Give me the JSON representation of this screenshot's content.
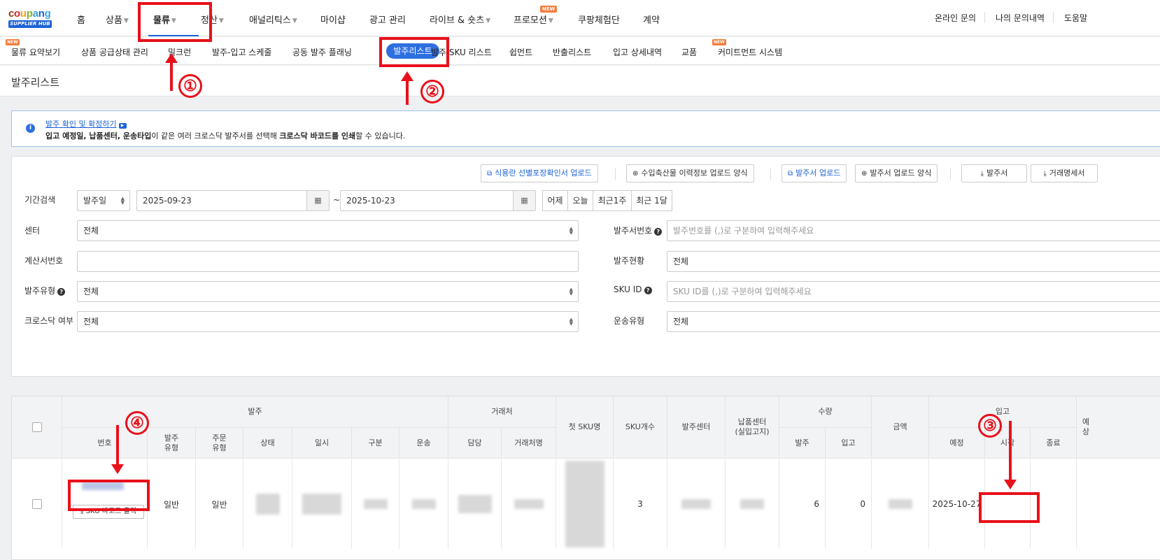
{
  "logo": {
    "word": "coupang",
    "badge": "SUPPLIER HUB"
  },
  "topnav": {
    "items": [
      {
        "label": "홈"
      },
      {
        "label": "상품"
      },
      {
        "label": "물류"
      },
      {
        "label": "정산"
      },
      {
        "label": "애널리틱스"
      },
      {
        "label": "마이샵"
      },
      {
        "label": "광고 관리"
      },
      {
        "label": "라이브 & 숏츠"
      },
      {
        "label": "프로모션"
      },
      {
        "label": "쿠팡체험단"
      },
      {
        "label": "계약"
      }
    ],
    "new_badge": "NEW",
    "right": [
      {
        "label": "온라인 문의"
      },
      {
        "label": "나의 문의내역"
      },
      {
        "label": "도움말"
      }
    ]
  },
  "subnav": {
    "items": [
      {
        "label": "물류 요약보기"
      },
      {
        "label": "상품 공급상태 관리"
      },
      {
        "label": "밀크런"
      },
      {
        "label": "발주-입고 스케줄"
      },
      {
        "label": "공동 발주 플래닝"
      },
      {
        "label": "발주리스트"
      },
      {
        "label": "발주 SKU 리스트"
      },
      {
        "label": "쉽먼트"
      },
      {
        "label": "반출리스트"
      },
      {
        "label": "입고 상세내역"
      },
      {
        "label": "교품"
      },
      {
        "label": "커미트먼트 시스템"
      }
    ],
    "new_badge": "NEW"
  },
  "page_title": "발주리스트",
  "info": {
    "link": "발주 확인 및 확정하기",
    "text_b1": "입고 예정일, 납품센터, 운송타입",
    "text_1": "이 같은 여러 크로스닥 발주서를 선택해 ",
    "text_b2": "크로스닥 바코드를 인쇄",
    "text_2": "할 수 있습니다."
  },
  "toolbar": {
    "food_upload": "식용란 선별포장확인서 업로드",
    "livestock_form": "수입축산물 이력정보 업로드 양식",
    "po_upload": "발주서 업로드",
    "po_upload_form": "발주서 업로드 양식",
    "po_download": "발주서",
    "statement_download": "거래명세서"
  },
  "filters": {
    "period_label": "기간검색",
    "period_type": "발주일",
    "date_from": "2025-09-23",
    "date_sep": "~",
    "date_to": "2025-10-23",
    "quick": [
      "어제",
      "오늘",
      "최근1주",
      "최근 1달"
    ],
    "center_label": "센터",
    "center_value": "전체",
    "invoice_label": "계산서번호",
    "invoice_value": "",
    "type_label": "발주유형",
    "type_value": "전체",
    "crossdock_label": "크로스닥 여부",
    "crossdock_value": "전체",
    "po_no_label": "발주서번호",
    "po_no_placeholder": "발주번호를 (,)로 구분하여 입력해주세요",
    "status_label": "발주현황",
    "status_value": "전체",
    "sku_label": "SKU ID",
    "sku_placeholder": "SKU ID를 (,)로 구분하여 입력해주세요",
    "transport_label": "운송유형",
    "transport_value": "전체"
  },
  "table": {
    "group_po": "발주",
    "group_vendor": "거래처",
    "group_qty": "수량",
    "group_inbound": "입고",
    "col_no": "번호",
    "col_po_type": "발주\n유형",
    "col_order_type": "주문\n유형",
    "col_status": "상태",
    "col_datetime": "일시",
    "col_division": "구분",
    "col_transport": "운송",
    "col_manager": "담당",
    "col_vendor_name": "거래처명",
    "col_first_sku": "첫 SKU명",
    "col_sku_count": "SKU개수",
    "col_po_center": "발주센터",
    "col_delivery_center": "납품센터\n(실입고지)",
    "col_qty_po": "발주",
    "col_qty_in": "입고",
    "col_amount": "금액",
    "col_in_plan": "예정",
    "col_in_start": "시작",
    "col_in_end": "종료",
    "col_more": "예\n상",
    "row": {
      "sku_barcode_btn": "SKU 바코드 출력",
      "po_type": "일반",
      "order_type": "일반",
      "sku_count": "3",
      "qty_po": "6",
      "qty_in": "0",
      "in_plan": "2025-10-27"
    }
  },
  "annotations": [
    "①",
    "②",
    "③",
    "④"
  ]
}
